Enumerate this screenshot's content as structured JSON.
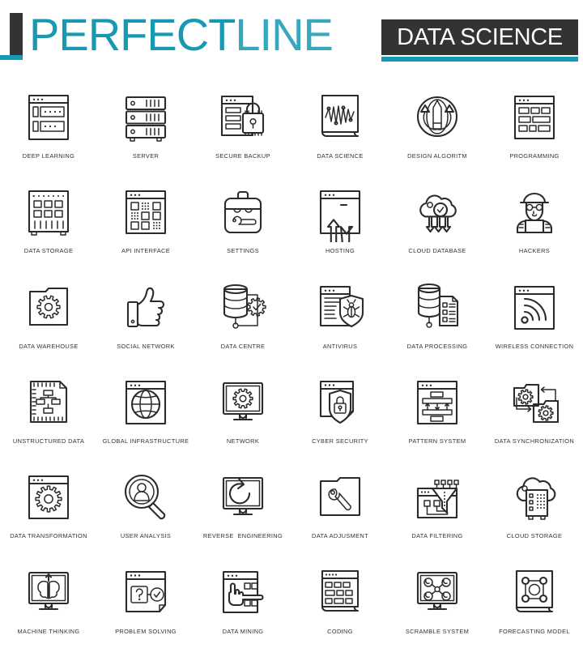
{
  "header": {
    "brand_primary": "PERFECT",
    "brand_secondary": "LINE",
    "badge": "DATA SCIENCE",
    "accent_color": "#1799b3",
    "dark_color": "#333333"
  },
  "icons": [
    {
      "label": "DEEP LEARNING",
      "icon": "browser-list-icon"
    },
    {
      "label": "SERVER",
      "icon": "server-rack-icon"
    },
    {
      "label": "SECURE BACKUP",
      "icon": "document-padlock-icon"
    },
    {
      "label": "DATA SCIENCE",
      "icon": "waveform-chart-icon"
    },
    {
      "label": "DESIGN ALGORITM",
      "icon": "pencil-refresh-circle-icon"
    },
    {
      "label": "PROGRAMMING",
      "icon": "browser-blocks-icon"
    },
    {
      "label": "DATA STORAGE",
      "icon": "storage-cabinet-icon"
    },
    {
      "label": "API INTERFACE",
      "icon": "browser-grid-dots-icon"
    },
    {
      "label": "SETTINGS",
      "icon": "toolbox-wrench-icon"
    },
    {
      "label": "HOSTING",
      "icon": "browser-up-down-arrows-icon"
    },
    {
      "label": "CLOUD DATABASE",
      "icon": "cloud-check-download-icon"
    },
    {
      "label": "HACKERS",
      "icon": "hacker-laptop-icon"
    },
    {
      "label": "DATA WAREHOUSE",
      "icon": "folder-gear-icon"
    },
    {
      "label": "SOCIAL NETWORK",
      "icon": "thumbs-up-icon"
    },
    {
      "label": "DATA CENTRE",
      "icon": "database-gear-check-icon"
    },
    {
      "label": "ANTIVIRUS",
      "icon": "document-shield-bug-icon"
    },
    {
      "label": "DATA PROCESSING",
      "icon": "database-document-icon"
    },
    {
      "label": "WIRELESS CONNECTION",
      "icon": "browser-wifi-icon"
    },
    {
      "label": "UNSTRUCTURED DATA",
      "icon": "document-flowchart-icon"
    },
    {
      "label": "GLOBAL INFRASTRUCTURE",
      "icon": "browser-globe-icon"
    },
    {
      "label": "NETWORK",
      "icon": "monitor-gear-icon"
    },
    {
      "label": "CYBER SECURITY",
      "icon": "browser-shield-lock-icon"
    },
    {
      "label": "PATTERN SYSTEM",
      "icon": "browser-pattern-arrows-icon"
    },
    {
      "label": "DATA SYNCHRONIZATION",
      "icon": "folders-sync-gears-icon"
    },
    {
      "label": "DATA TRANSFORMATION",
      "icon": "browser-gear-icon"
    },
    {
      "label": "USER ANALYSIS",
      "icon": "magnifier-user-icon"
    },
    {
      "label": "REVERSE  ENGINEERING",
      "icon": "monitor-refresh-icon"
    },
    {
      "label": "DATA ADJUSMENT",
      "icon": "folder-wrench-icon"
    },
    {
      "label": "DATA FILTERING",
      "icon": "browser-funnel-icon"
    },
    {
      "label": "CLOUD STORAGE",
      "icon": "cloud-server-icon"
    },
    {
      "label": "MACHINE THINKING",
      "icon": "monitor-brain-icon"
    },
    {
      "label": "PROBLEM SOLVING",
      "icon": "browser-question-check-icon"
    },
    {
      "label": "DATA MINING",
      "icon": "browser-hand-icon"
    },
    {
      "label": "CODING",
      "icon": "document-code-blocks-icon"
    },
    {
      "label": "SCRAMBLE SYSTEM",
      "icon": "monitor-nodes-icon"
    },
    {
      "label": "FORECASTING MODEL",
      "icon": "document-node-square-icon"
    }
  ]
}
